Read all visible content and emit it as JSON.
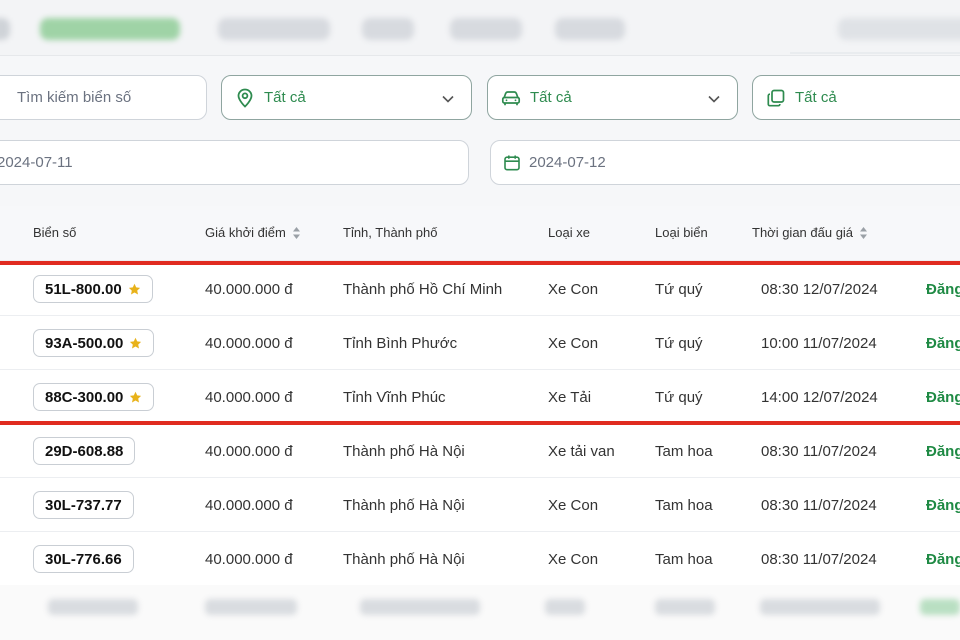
{
  "filters": {
    "search_placeholder": "Tìm kiếm biển số",
    "province_value": "Tất cả",
    "vehicle_type_value": "Tất cả",
    "plate_type_value": "Tất cả",
    "date_from": "2024-07-11",
    "date_to": "2024-07-12"
  },
  "table": {
    "headers": {
      "plate": "Biển số",
      "price": "Giá khởi điểm",
      "province": "Tỉnh, Thành phố",
      "vehicle_type": "Loại xe",
      "plate_type": "Loại biển",
      "auction_time": "Thời gian đấu giá"
    },
    "rows": [
      {
        "plate": "51L-800.00",
        "starred": true,
        "price": "40.000.000 đ",
        "province": "Thành phố Hồ Chí Minh",
        "vehicle_type": "Xe Con",
        "plate_type": "Tứ quý",
        "time": "08:30 12/07/2024",
        "status": "Đăng"
      },
      {
        "plate": "93A-500.00",
        "starred": true,
        "price": "40.000.000 đ",
        "province": "Tỉnh Bình Phước",
        "vehicle_type": "Xe Con",
        "plate_type": "Tứ quý",
        "time": "10:00 11/07/2024",
        "status": "Đăng"
      },
      {
        "plate": "88C-300.00",
        "starred": true,
        "price": "40.000.000 đ",
        "province": "Tỉnh Vĩnh Phúc",
        "vehicle_type": "Xe Tải",
        "plate_type": "Tứ quý",
        "time": "14:00 12/07/2024",
        "status": "Đăng"
      },
      {
        "plate": "29D-608.88",
        "starred": false,
        "price": "40.000.000 đ",
        "province": "Thành phố Hà Nội",
        "vehicle_type": "Xe tải van",
        "plate_type": "Tam hoa",
        "time": "08:30 11/07/2024",
        "status": "Đăng"
      },
      {
        "plate": "30L-737.77",
        "starred": false,
        "price": "40.000.000 đ",
        "province": "Thành phố Hà Nội",
        "vehicle_type": "Xe Con",
        "plate_type": "Tam hoa",
        "time": "08:30 11/07/2024",
        "status": "Đăng"
      },
      {
        "plate": "30L-776.66",
        "starred": false,
        "price": "40.000.000 đ",
        "province": "Thành phố Hà Nội",
        "vehicle_type": "Xe Con",
        "plate_type": "Tam hoa",
        "time": "08:30 11/07/2024",
        "status": "Đăng"
      }
    ]
  },
  "colors": {
    "accent_green": "#1f8a44",
    "highlight_red": "#e02b20",
    "star_gold": "#e8b21a"
  },
  "icons": {
    "province": "location-pin-icon",
    "vehicle": "car-icon",
    "plate_type": "copy-icon",
    "date": "calendar-icon",
    "dropdown": "chevron-down-icon",
    "sort": "sort-icon",
    "star": "star-icon"
  }
}
